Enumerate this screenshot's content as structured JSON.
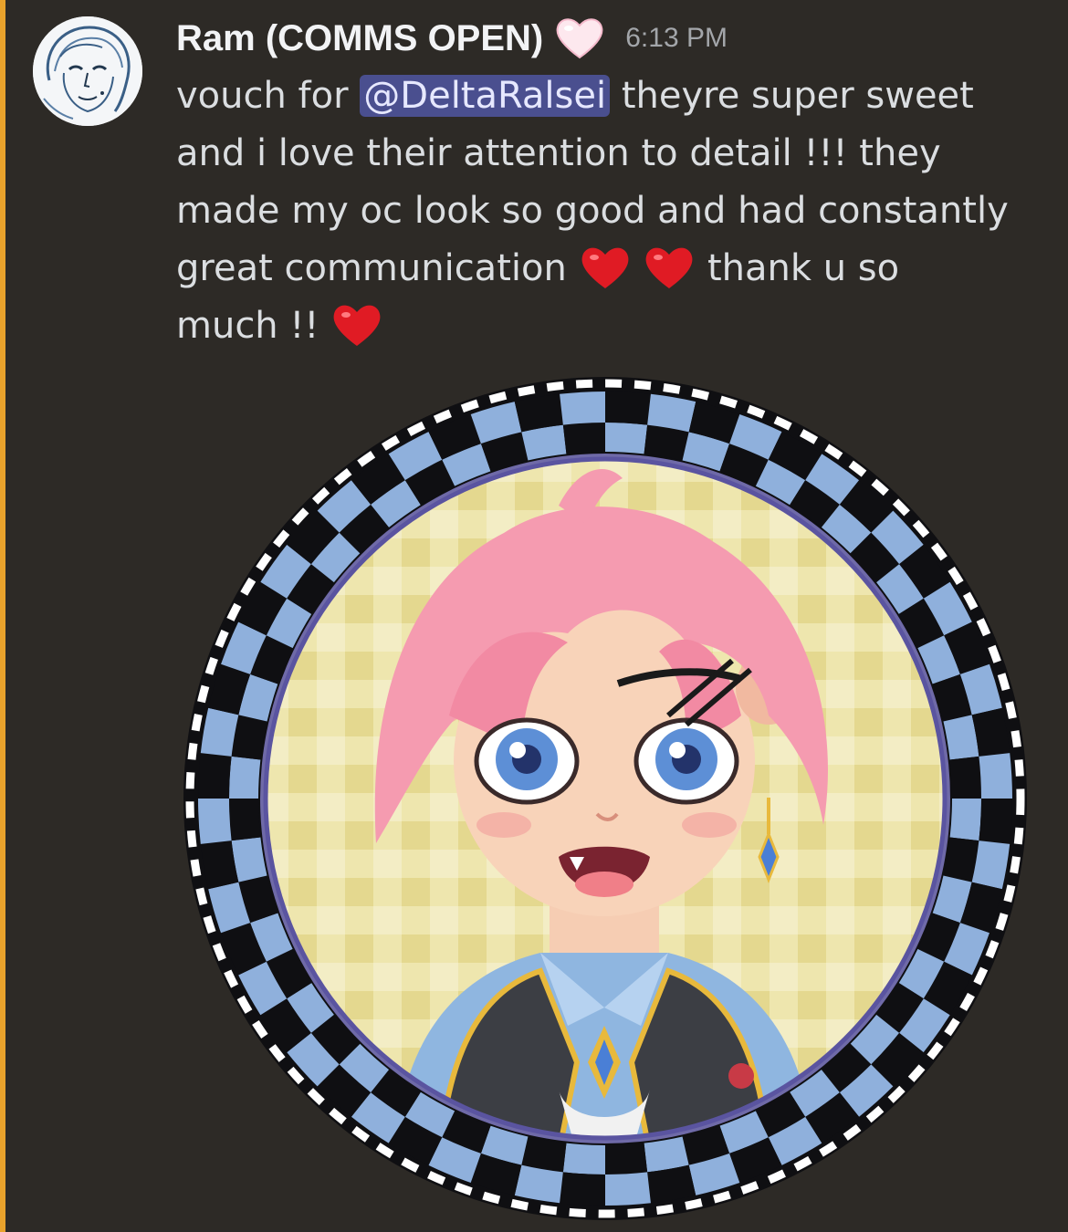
{
  "message": {
    "author": "Ram (COMMS OPEN)",
    "author_badge_icon": "white-heart-emoji",
    "timestamp": "6:13 PM",
    "avatar_icon": "user-avatar-sketch",
    "content": {
      "line1_prefix": "vouch for ",
      "mention": "@DeltaRalsei",
      "line1_suffix": " theyre super sweet",
      "line2": "and i love their attention to detail !!! they",
      "line3": "made my oc look so good and had constantly",
      "line4_prefix": "great communication ",
      "line4_suffix": " thank u so",
      "line5_prefix": "much !! "
    },
    "emoji": [
      "red-heart",
      "red-heart",
      "red-heart"
    ],
    "attachment_icon": "character-portrait-checkered-frame"
  },
  "colors": {
    "background": "#2d2a26",
    "highlight_bar": "#e8a22c",
    "mention_bg": "#4a4f8f",
    "checker_blue": "#8fb0dc",
    "checker_black": "#0f0f12",
    "portrait_bg": "#e9e0a2"
  }
}
